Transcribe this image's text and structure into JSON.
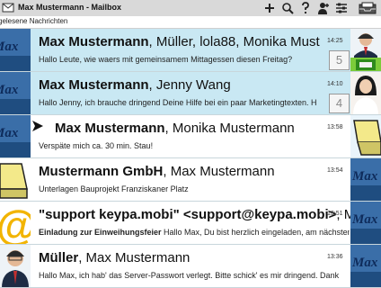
{
  "app": {
    "title": "Max Mustermann - Mailbox",
    "filter_label": "gelesene Nachrichten"
  },
  "toolbar_icons": [
    "add-icon",
    "search-icon",
    "help-icon",
    "contacts-icon",
    "settings-icon",
    "inbox-icon"
  ],
  "messages": [
    {
      "from_bold": "Max Mustermann",
      "from_rest": ", Müller, lola88, Monika Must",
      "subject_bold": "",
      "subject_rest": "Hallo Leute, wie waers mit gemeinsamem Mittagessen diesen Freitag?",
      "time": "14:25",
      "count": "5",
      "state": "unread"
    },
    {
      "from_bold": "Max Mustermann",
      "from_rest": ", Jenny Wang",
      "subject_bold": "",
      "subject_rest": "Hallo Jenny, ich brauche dringend Deine Hilfe bei ein paar Marketingtexten. H",
      "time": "14:10",
      "count": "4",
      "state": "unread"
    },
    {
      "from_bold": "Max Mustermann",
      "from_rest": ", Monika Mustermann",
      "subject_bold": "",
      "subject_rest": "Verspäte mich ca. 30 min. Stau!",
      "time": "13:58",
      "count": "",
      "state": "read"
    },
    {
      "from_bold": "Mustermann GmbH",
      "from_rest": ", Max Mustermann",
      "subject_bold": "",
      "subject_rest": "Unterlagen Bauprojekt Franziskaner Platz",
      "time": "13:54",
      "count": "",
      "state": "read"
    },
    {
      "from_bold": "\"support keypa.mobi\" <support@keypa.mobi>",
      "from_rest": ", Max",
      "subject_bold": "Einladung zur Einweihungsfeier",
      "subject_rest": " Hallo Max, Du bist herzlich eingeladen, am nächsten",
      "time": "13:51",
      "count": "",
      "state": "read"
    },
    {
      "from_bold": "Müller",
      "from_rest": ", Max Mustermann",
      "subject_bold": "",
      "subject_rest": "Hallo Max,  ich hab' das Server-Passwort verlegt. Bitte schick' es mir dringend. Dank",
      "time": "13:36",
      "count": "",
      "state": "read"
    }
  ],
  "thumb_text": "Max"
}
